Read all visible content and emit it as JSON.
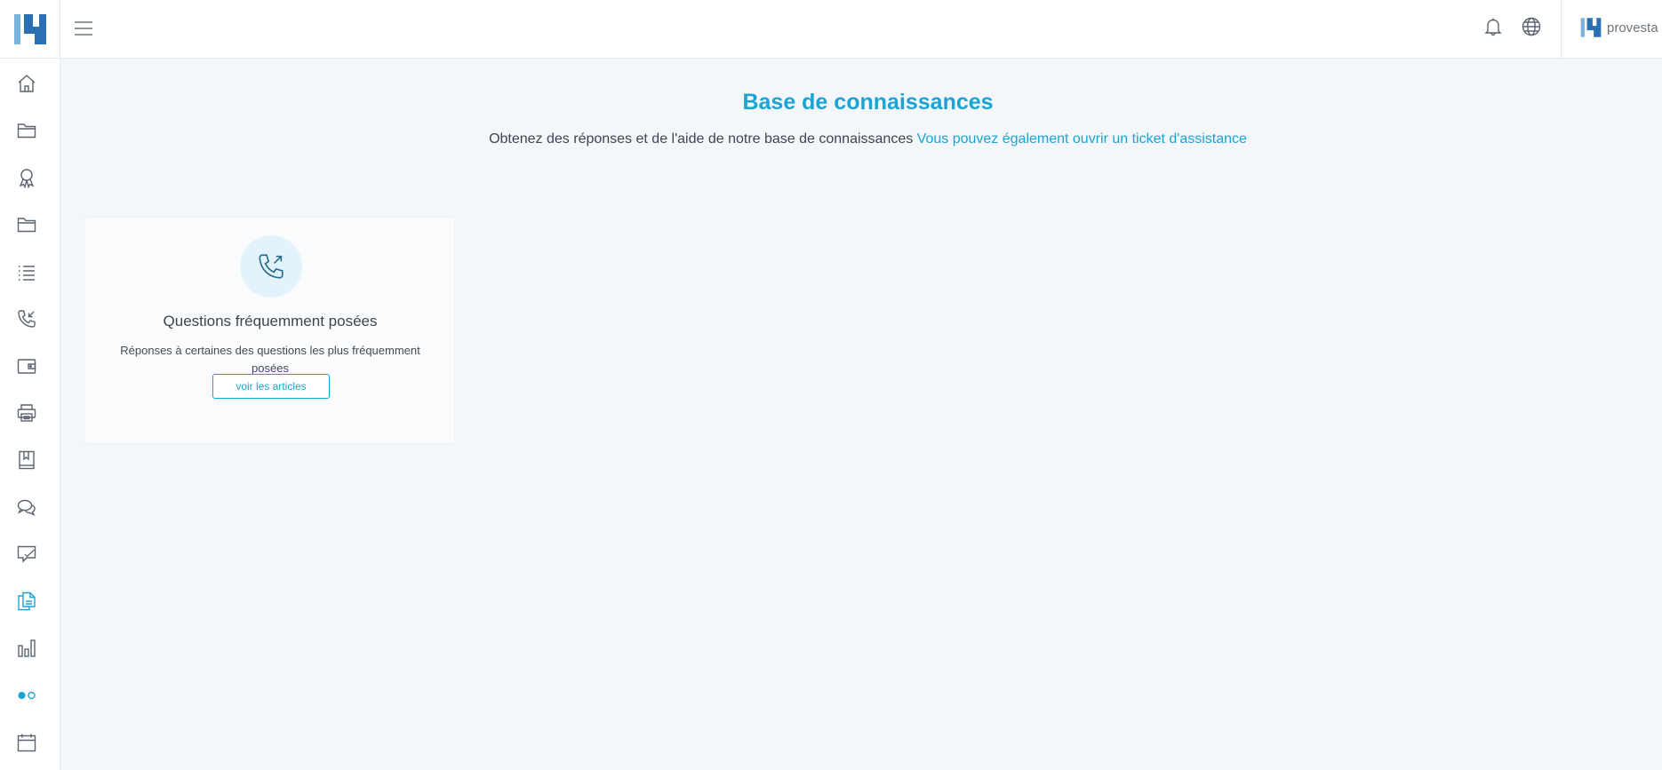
{
  "header": {
    "account_name": "provesta"
  },
  "sidebar": {
    "items": [
      {
        "name": "home-icon"
      },
      {
        "name": "folder-icon"
      },
      {
        "name": "award-icon"
      },
      {
        "name": "folder-icon"
      },
      {
        "name": "list-icon"
      },
      {
        "name": "phone-incoming-icon"
      },
      {
        "name": "wallet-icon"
      },
      {
        "name": "printer-icon"
      },
      {
        "name": "book-icon"
      },
      {
        "name": "chat-icon"
      },
      {
        "name": "message-icon"
      },
      {
        "name": "documents-icon",
        "active": true
      },
      {
        "name": "bar-chart-icon"
      },
      {
        "name": "toggle-icon"
      },
      {
        "name": "calendar-icon"
      }
    ]
  },
  "main": {
    "title": "Base de connaissances",
    "subtitle_text": "Obtenez des réponses et de l'aide de notre base de connaissances",
    "subtitle_link": "Vous pouvez également ouvrir un ticket d'assistance",
    "cards": [
      {
        "icon": "phone-outgoing-icon",
        "title": "Questions fréquemment posées",
        "description": "Réponses à certaines des questions les plus fréquemment posées",
        "button_label": "voir les articles"
      }
    ]
  },
  "colors": {
    "accent": "#1aa4d6",
    "brand_dark": "#2a6fb3",
    "brand_light": "#7ab3de",
    "background": "#f3f7f9",
    "icon_gray": "#5b6470"
  }
}
